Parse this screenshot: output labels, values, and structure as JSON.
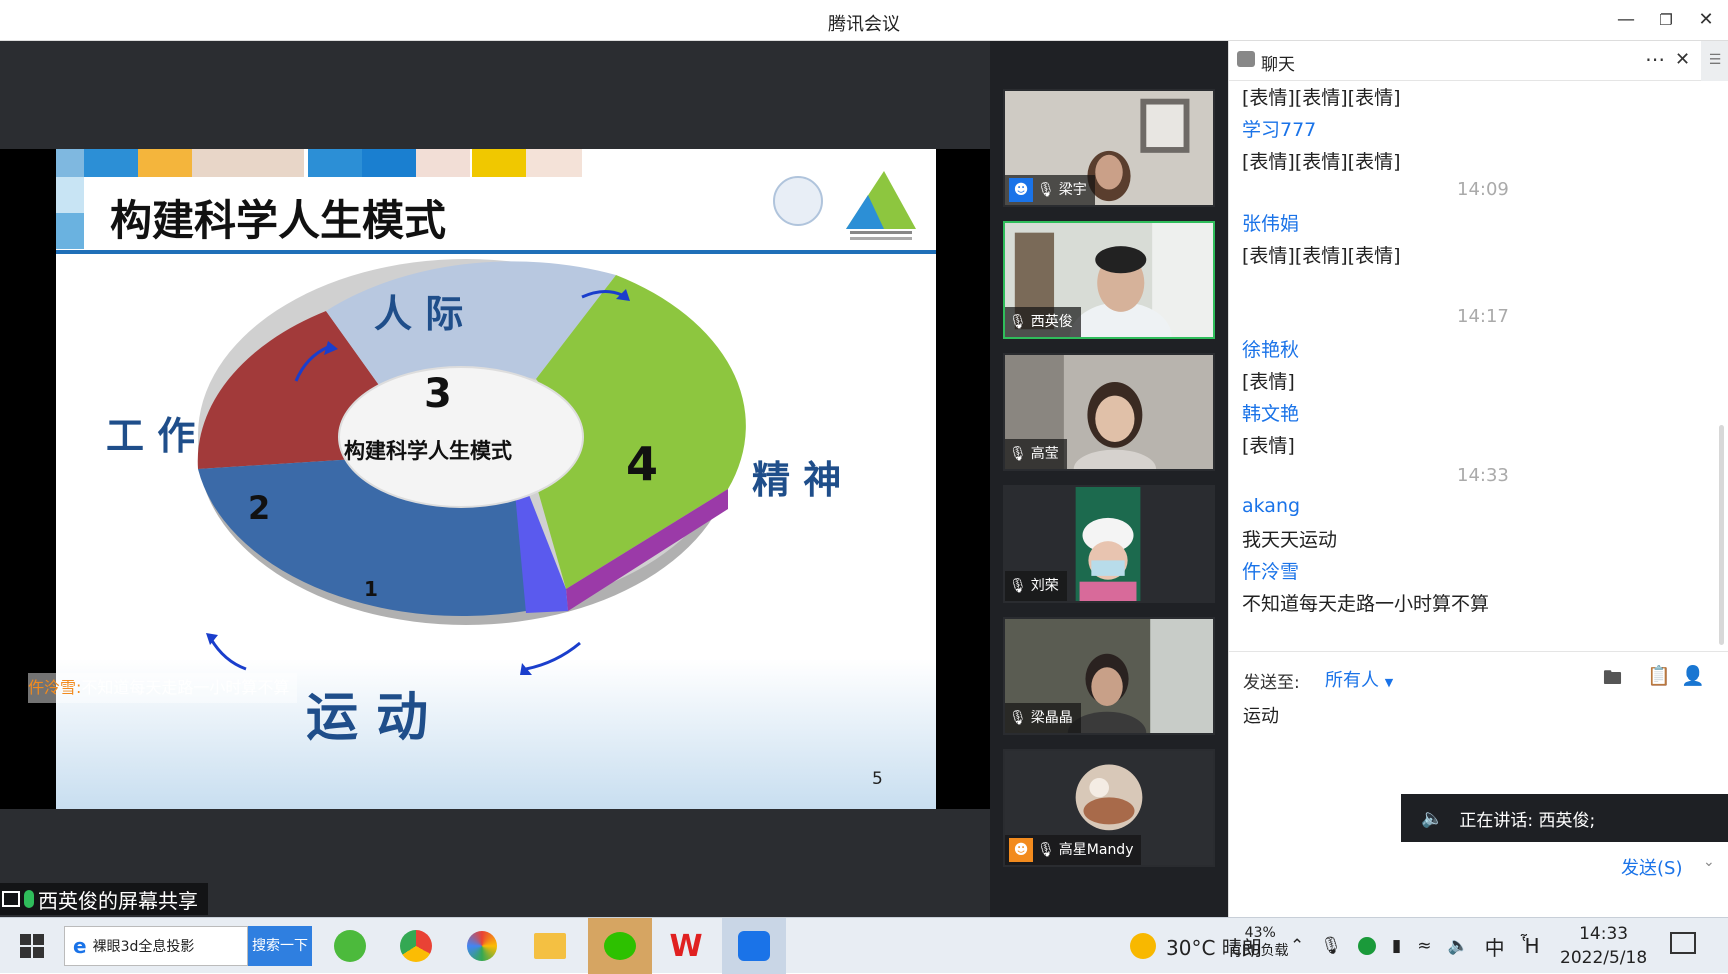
{
  "window": {
    "title": "腾讯会议"
  },
  "slide": {
    "title": "构建科学人生模式",
    "center_label": "构建科学人生模式",
    "labels": {
      "renji": "人 际",
      "gongzuo": "工 作",
      "jingshen": "精 神",
      "yundong": "运 动"
    },
    "segment_numbers": {
      "s1": "1",
      "s2": "2",
      "s3": "3",
      "s4": "4"
    },
    "page_number": "5",
    "overlay_sender": "仵泠雪:",
    "overlay_text": "不知道每天走路一小时算不算",
    "colors": {
      "red": "#a23a3a",
      "green": "#8dc63f",
      "blue": "#3b6aa8",
      "lightblue": "#b8c8e0",
      "purple": "#9b3aa8",
      "title_blue": "#1f4e8a"
    }
  },
  "share_bar": {
    "label": "西英俊的屏幕共享"
  },
  "participants": [
    {
      "name": "梁宇",
      "mic": "muted"
    },
    {
      "name": "西英俊",
      "mic": "on",
      "active": true
    },
    {
      "name": "高莹",
      "mic": "muted"
    },
    {
      "name": "刘荣",
      "mic": "muted"
    },
    {
      "name": "梁晶晶",
      "mic": "muted"
    },
    {
      "name": "高星Mandy",
      "mic": "muted"
    }
  ],
  "chat": {
    "title": "聊天",
    "messages": [
      {
        "kind": "text",
        "text": "[表情][表情][表情]"
      },
      {
        "kind": "name",
        "text": "学习777"
      },
      {
        "kind": "text",
        "text": "[表情][表情][表情]"
      },
      {
        "kind": "time",
        "text": "14:09"
      },
      {
        "kind": "name",
        "text": "张伟娟"
      },
      {
        "kind": "text",
        "text": "[表情][表情][表情]"
      },
      {
        "kind": "time",
        "text": "14:17"
      },
      {
        "kind": "name",
        "text": "徐艳秋"
      },
      {
        "kind": "text",
        "text": "[表情]"
      },
      {
        "kind": "name",
        "text": "韩文艳"
      },
      {
        "kind": "text",
        "text": "[表情]"
      },
      {
        "kind": "time",
        "text": "14:33"
      },
      {
        "kind": "name",
        "text": "akang"
      },
      {
        "kind": "text",
        "text": "我天天运动"
      },
      {
        "kind": "name",
        "text": "仵泠雪"
      },
      {
        "kind": "text",
        "text": "不知道每天走路一小时算不算"
      }
    ],
    "send_to_label": "发送至:",
    "send_to_value": "所有人",
    "draft": "运动",
    "speaking_label": "正在讲话: 西英俊;",
    "send_button": "发送(S)"
  },
  "taskbar": {
    "search_text": "裸眼3d全息投影",
    "search_button": "搜索一下",
    "weather": "30°C 晴朗",
    "cpu_percent": "43%",
    "cpu_label": "CPU负载",
    "ime": "中",
    "time": "14:33",
    "date": "2022/5/18"
  }
}
